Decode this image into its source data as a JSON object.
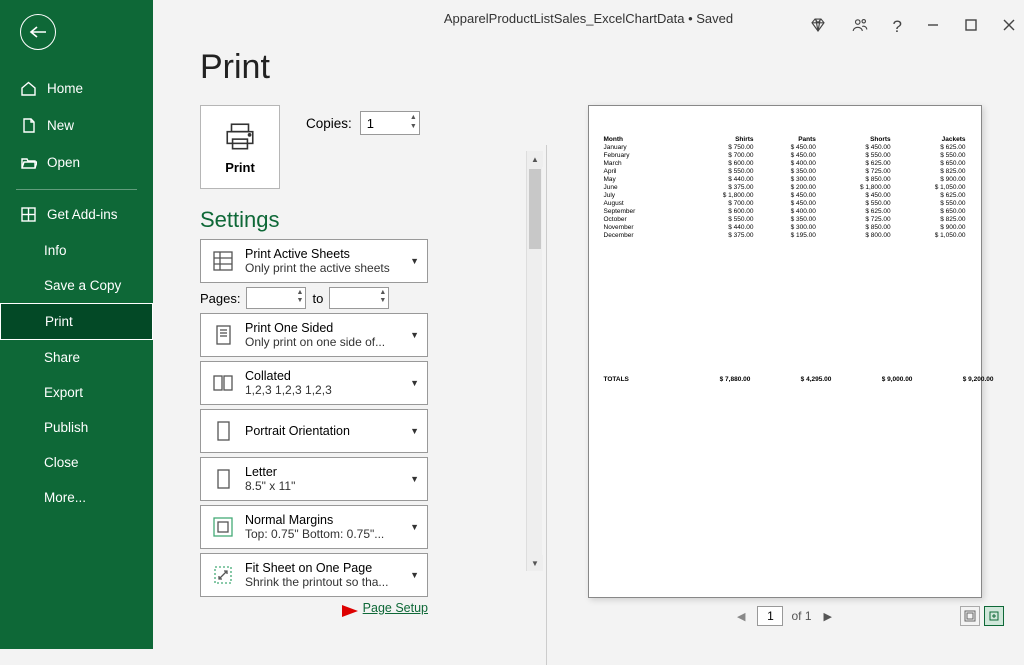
{
  "titlebar": {
    "title": "ApparelProductListSales_ExcelChartData • Saved"
  },
  "sidebar": {
    "home": "Home",
    "new": "New",
    "open": "Open",
    "addins": "Get Add-ins",
    "info": "Info",
    "save_copy": "Save a Copy",
    "print": "Print",
    "share": "Share",
    "export": "Export",
    "publish": "Publish",
    "close": "Close",
    "more": "More..."
  },
  "page": {
    "title": "Print",
    "settings": "Settings"
  },
  "print_button": {
    "label": "Print"
  },
  "copies": {
    "label": "Copies:",
    "value": "1"
  },
  "combo": {
    "active": {
      "t1": "Print Active Sheets",
      "t2": "Only print the active sheets"
    },
    "sided": {
      "t1": "Print One Sided",
      "t2": "Only print on one side of..."
    },
    "collated": {
      "t1": "Collated",
      "t2": "1,2,3   1,2,3   1,2,3"
    },
    "orient": {
      "t1": "Portrait Orientation",
      "t2": ""
    },
    "paper": {
      "t1": "Letter",
      "t2": "8.5\" x 11\""
    },
    "margins": {
      "t1": "Normal Margins",
      "t2": "Top: 0.75\" Bottom: 0.75\"..."
    },
    "fit": {
      "t1": "Fit Sheet on One Page",
      "t2": "Shrink the printout so tha..."
    }
  },
  "pages": {
    "label": "Pages:",
    "to": "to"
  },
  "pagesetup": {
    "label": "Page Setup"
  },
  "preview_nav": {
    "page": "1",
    "of": "of 1"
  },
  "chart_data": {
    "type": "table",
    "columns": [
      "Month",
      "Shirts",
      "Pants",
      "Shorts",
      "Jackets"
    ],
    "rows": [
      {
        "m": "January",
        "s": "$   750.00",
        "p": "$   450.00",
        "sh": "$     450.00",
        "j": "$   625.00"
      },
      {
        "m": "February",
        "s": "$   700.00",
        "p": "$   450.00",
        "sh": "$     550.00",
        "j": "$   550.00"
      },
      {
        "m": "March",
        "s": "$   600.00",
        "p": "$   400.00",
        "sh": "$     625.00",
        "j": "$   650.00"
      },
      {
        "m": "April",
        "s": "$   550.00",
        "p": "$   350.00",
        "sh": "$     725.00",
        "j": "$   825.00"
      },
      {
        "m": "May",
        "s": "$   440.00",
        "p": "$   300.00",
        "sh": "$     850.00",
        "j": "$   900.00"
      },
      {
        "m": "June",
        "s": "$   375.00",
        "p": "$   200.00",
        "sh": "$  1,800.00",
        "j": "$ 1,050.00"
      },
      {
        "m": "July",
        "s": "$ 1,800.00",
        "p": "$   450.00",
        "sh": "$     450.00",
        "j": "$   625.00"
      },
      {
        "m": "August",
        "s": "$   700.00",
        "p": "$   450.00",
        "sh": "$     550.00",
        "j": "$   550.00"
      },
      {
        "m": "September",
        "s": "$   600.00",
        "p": "$   400.00",
        "sh": "$     625.00",
        "j": "$   650.00"
      },
      {
        "m": "October",
        "s": "$   550.00",
        "p": "$   350.00",
        "sh": "$     725.00",
        "j": "$   825.00"
      },
      {
        "m": "November",
        "s": "$   440.00",
        "p": "$   300.00",
        "sh": "$     850.00",
        "j": "$   900.00"
      },
      {
        "m": "December",
        "s": "$   375.00",
        "p": "$   195.00",
        "sh": "$     800.00",
        "j": "$ 1,050.00"
      }
    ],
    "totals": {
      "label": "TOTALS",
      "s": "$ 7,880.00",
      "p": "$ 4,295.00",
      "sh": "$   9,000.00",
      "j": "$ 9,200.00"
    }
  }
}
